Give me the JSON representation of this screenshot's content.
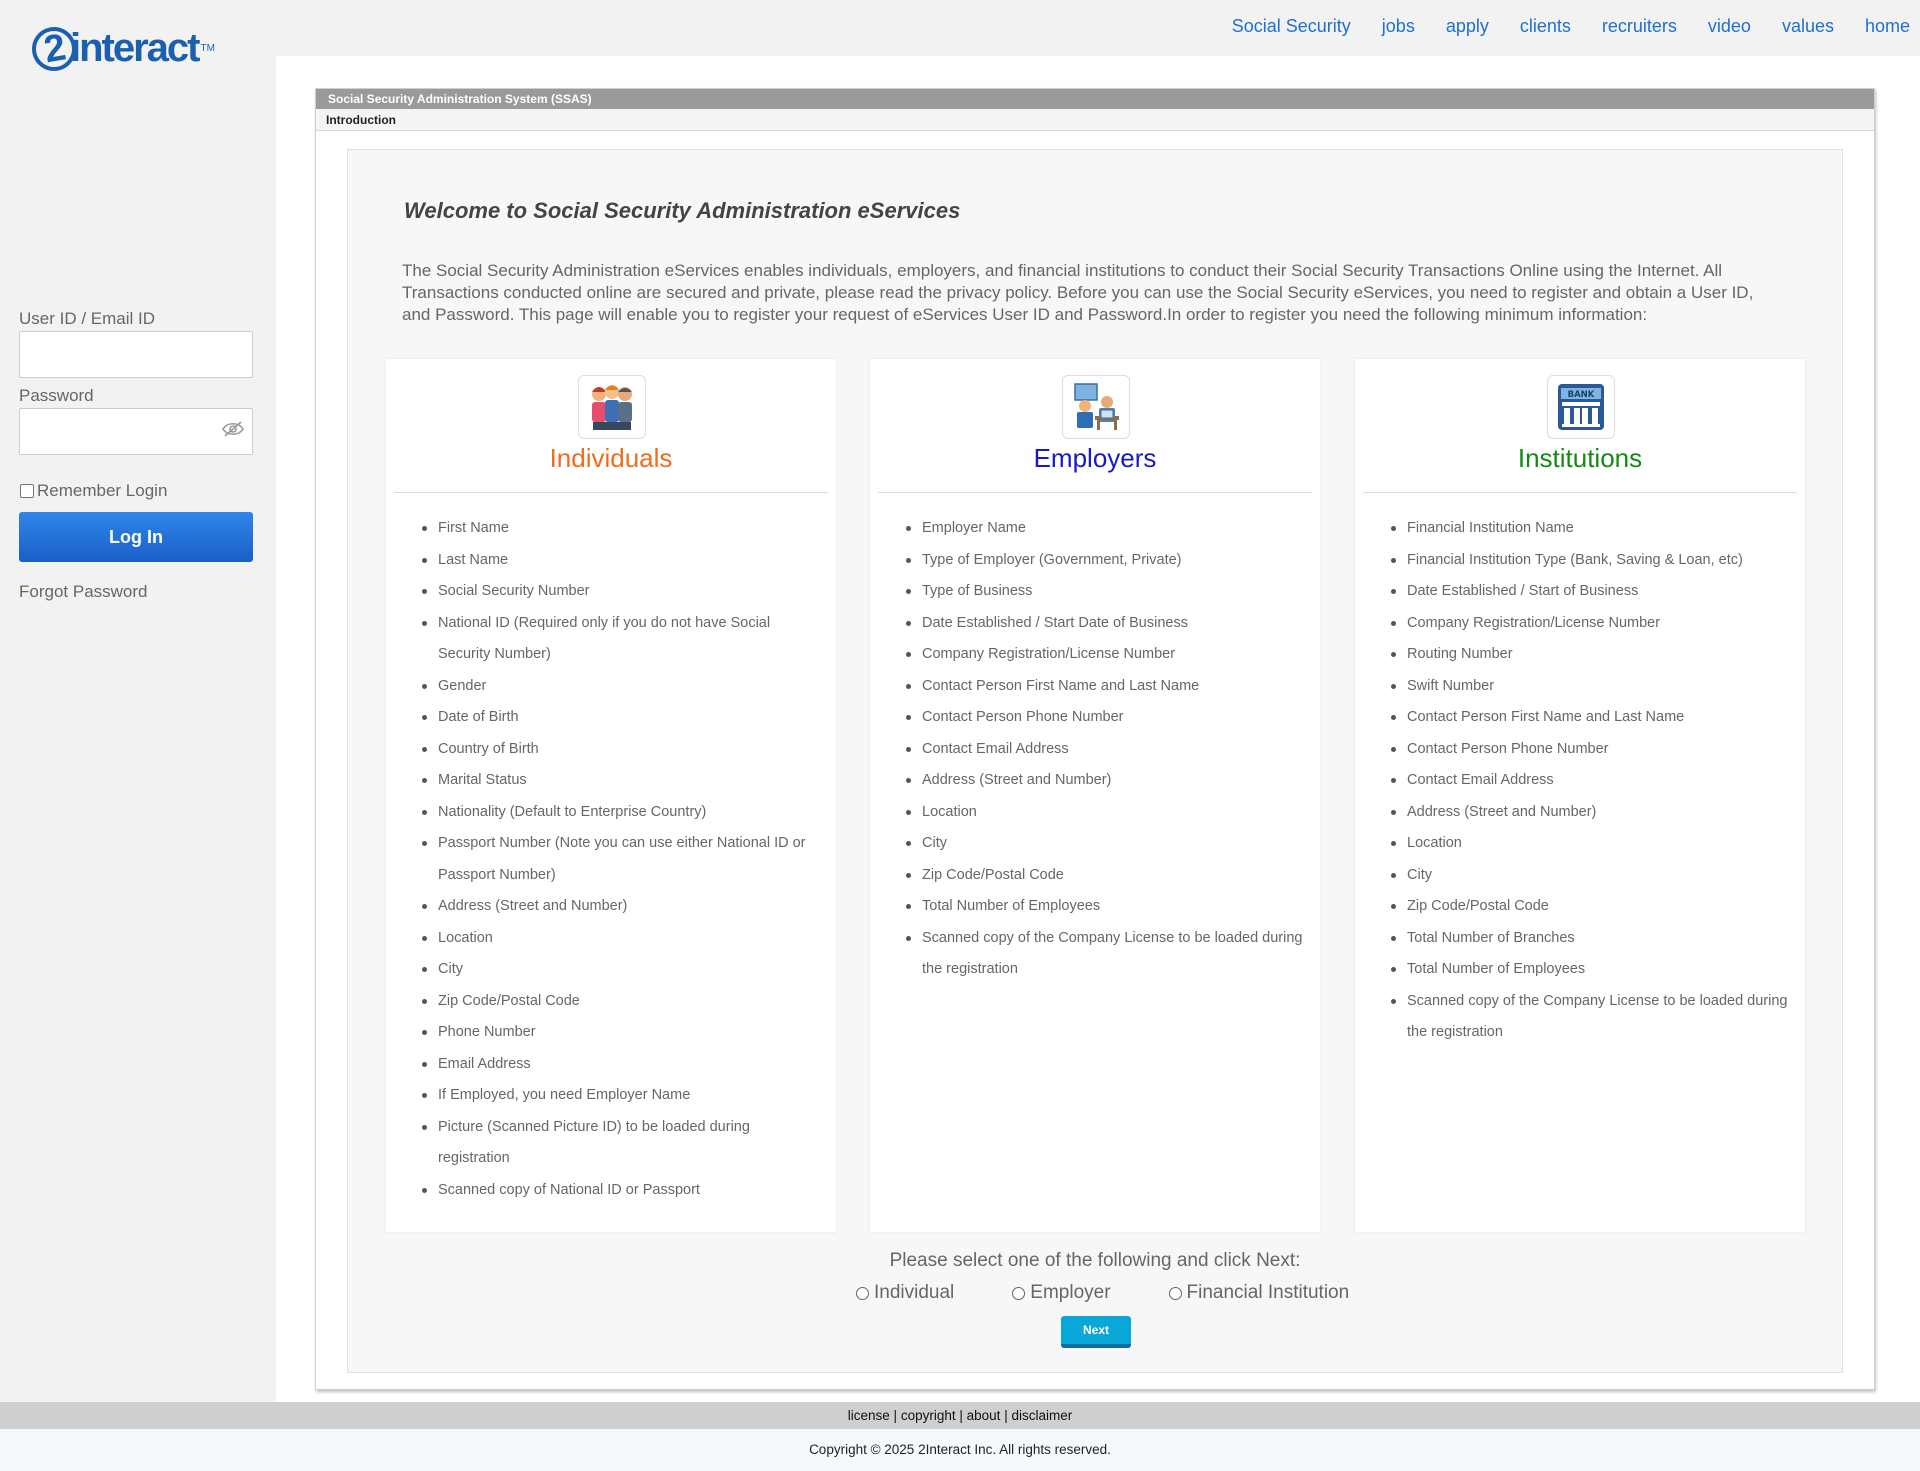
{
  "brand": {
    "logo_text": "interact",
    "logo_digit": "2",
    "logo_tm": "TM"
  },
  "nav": [
    "Social Security",
    "jobs",
    "apply",
    "clients",
    "recruiters",
    "video",
    "values",
    "home"
  ],
  "login": {
    "user_label": "User ID / Email ID",
    "user_value": "",
    "password_label": "Password",
    "password_value": "",
    "remember_label": "Remember Login",
    "remember_checked": false,
    "login_button": "Log In",
    "forgot_link": "Forgot Password"
  },
  "panel": {
    "title": "Social Security Administration System (SSAS)",
    "subtitle": "Introduction"
  },
  "welcome": "Welcome to Social Security Administration eServices",
  "intro": "The Social Security Administration eServices enables individuals, employers, and financial institutions to conduct their Social Security Transactions Online using the Internet. All Transactions conducted online are secured and private, please read the privacy policy. Before you can use the Social Security eServices, you need to register and obtain a User ID, and Password. This page will enable you to register your request of eServices User ID and Password.In order to register you need the following minimum information:",
  "cards": [
    {
      "title": "Individuals",
      "color": "#f26b1d",
      "icon": "people-group-icon",
      "items": [
        "First Name",
        "Last Name",
        "Social Security Number",
        "National ID (Required only if you do not have Social Security Number)",
        "Gender",
        "Date of Birth",
        "Country of Birth",
        "Marital Status",
        "Nationality (Default to Enterprise Country)",
        "Passport Number (Note you can use either National ID or Passport Number)",
        "Address (Street and Number)",
        "Location",
        "City",
        "Zip Code/Postal Code",
        "Phone Number",
        "Email Address",
        "If Employed, you need Employer Name",
        "Picture (Scanned Picture ID) to be loaded during registration",
        "Scanned copy of National ID or Passport"
      ]
    },
    {
      "title": "Employers",
      "color": "#1818c8",
      "icon": "office-workers-icon",
      "items": [
        "Employer Name",
        "Type of Employer (Government, Private)",
        "Type of Business",
        "Date Established / Start Date of Business",
        "Company Registration/License Number",
        "Contact Person First Name and Last Name",
        "Contact Person Phone Number",
        "Contact Email Address",
        "Address (Street and Number)",
        "Location",
        "City",
        "Zip Code/Postal Code",
        "Total Number of Employees",
        "Scanned copy of the Company License to be loaded during the registration"
      ]
    },
    {
      "title": "Institutions",
      "color": "#138a13",
      "icon": "bank-icon",
      "icon_text": "BANK",
      "items": [
        "Financial Institution Name",
        "Financial Institution Type (Bank, Saving & Loan, etc)",
        "Date Established / Start of Business",
        "Company Registration/License Number",
        "Routing Number",
        "Swift Number",
        "Contact Person First Name and Last Name",
        "Contact Person Phone Number",
        "Contact Email Address",
        "Address (Street and Number)",
        "Location",
        "City",
        "Zip Code/Postal Code",
        "Total Number of Branches",
        "Total Number of Employees",
        "Scanned copy of the Company License to be loaded during the registration"
      ]
    }
  ],
  "selection": {
    "prompt": "Please select one of the following and click Next:",
    "options": [
      "Individual",
      "Employer",
      "Financial Institution"
    ],
    "next_button": "Next"
  },
  "footer": {
    "links": [
      "license",
      "copyright",
      "about",
      "disclaimer"
    ],
    "separator": "|",
    "copyright": "Copyright © 2025 2Interact Inc. All rights reserved."
  }
}
